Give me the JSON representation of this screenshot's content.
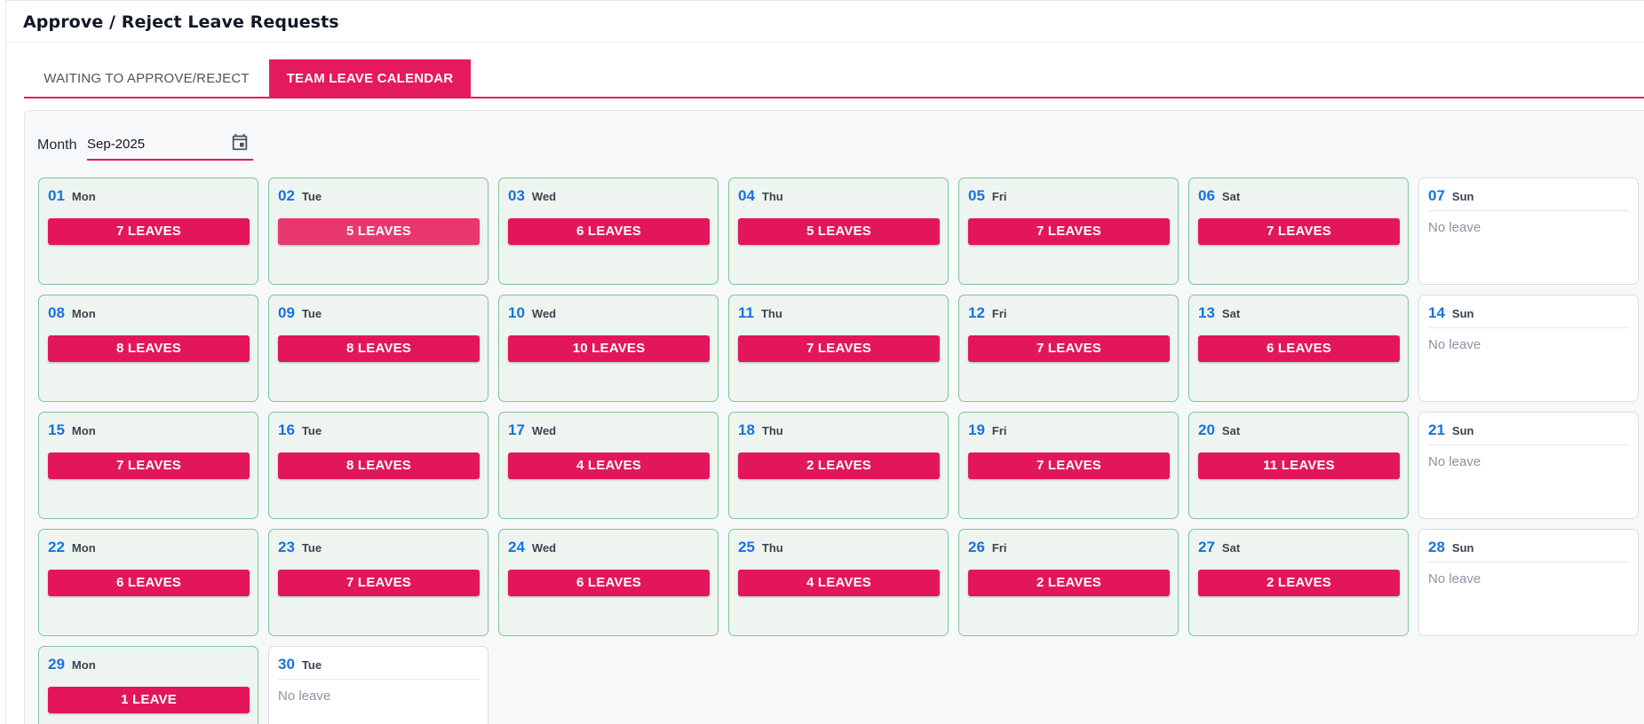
{
  "page": {
    "title": "Approve / Reject Leave Requests"
  },
  "tabs": [
    {
      "label": "WAITING TO APPROVE/REJECT",
      "active": false
    },
    {
      "label": "TEAM LEAVE CALENDAR",
      "active": true
    }
  ],
  "filter": {
    "month_label": "Month",
    "month_value": "Sep-2025",
    "calendar_icon": "calendar-icon"
  },
  "colors": {
    "accent": "#e5195e",
    "day_number": "#1673e0",
    "leave_card_border": "#7cc795",
    "leave_card_bg": "#eef5f0"
  },
  "days": [
    {
      "num": "01",
      "day": "Mon",
      "leaves": "7 LEAVES"
    },
    {
      "num": "02",
      "day": "Tue",
      "leaves": "5 LEAVES"
    },
    {
      "num": "03",
      "day": "Wed",
      "leaves": "6 LEAVES"
    },
    {
      "num": "04",
      "day": "Thu",
      "leaves": "5 LEAVES"
    },
    {
      "num": "05",
      "day": "Fri",
      "leaves": "7 LEAVES"
    },
    {
      "num": "06",
      "day": "Sat",
      "leaves": "7 LEAVES"
    },
    {
      "num": "07",
      "day": "Sun",
      "no_leave": "No leave"
    },
    {
      "num": "08",
      "day": "Mon",
      "leaves": "8 LEAVES"
    },
    {
      "num": "09",
      "day": "Tue",
      "leaves": "8 LEAVES"
    },
    {
      "num": "10",
      "day": "Wed",
      "leaves": "10 LEAVES"
    },
    {
      "num": "11",
      "day": "Thu",
      "leaves": "7 LEAVES"
    },
    {
      "num": "12",
      "day": "Fri",
      "leaves": "7 LEAVES"
    },
    {
      "num": "13",
      "day": "Sat",
      "leaves": "6 LEAVES"
    },
    {
      "num": "14",
      "day": "Sun",
      "no_leave": "No leave"
    },
    {
      "num": "15",
      "day": "Mon",
      "leaves": "7 LEAVES"
    },
    {
      "num": "16",
      "day": "Tue",
      "leaves": "8 LEAVES"
    },
    {
      "num": "17",
      "day": "Wed",
      "leaves": "4 LEAVES"
    },
    {
      "num": "18",
      "day": "Thu",
      "leaves": "2 LEAVES"
    },
    {
      "num": "19",
      "day": "Fri",
      "leaves": "7 LEAVES"
    },
    {
      "num": "20",
      "day": "Sat",
      "leaves": "11 LEAVES"
    },
    {
      "num": "21",
      "day": "Sun",
      "no_leave": "No leave"
    },
    {
      "num": "22",
      "day": "Mon",
      "leaves": "6 LEAVES"
    },
    {
      "num": "23",
      "day": "Tue",
      "leaves": "7 LEAVES"
    },
    {
      "num": "24",
      "day": "Wed",
      "leaves": "6 LEAVES"
    },
    {
      "num": "25",
      "day": "Thu",
      "leaves": "4 LEAVES"
    },
    {
      "num": "26",
      "day": "Fri",
      "leaves": "2 LEAVES"
    },
    {
      "num": "27",
      "day": "Sat",
      "leaves": "2 LEAVES"
    },
    {
      "num": "28",
      "day": "Sun",
      "no_leave": "No leave"
    },
    {
      "num": "29",
      "day": "Mon",
      "leaves": "1 LEAVE"
    },
    {
      "num": "30",
      "day": "Tue",
      "no_leave": "No leave"
    }
  ]
}
